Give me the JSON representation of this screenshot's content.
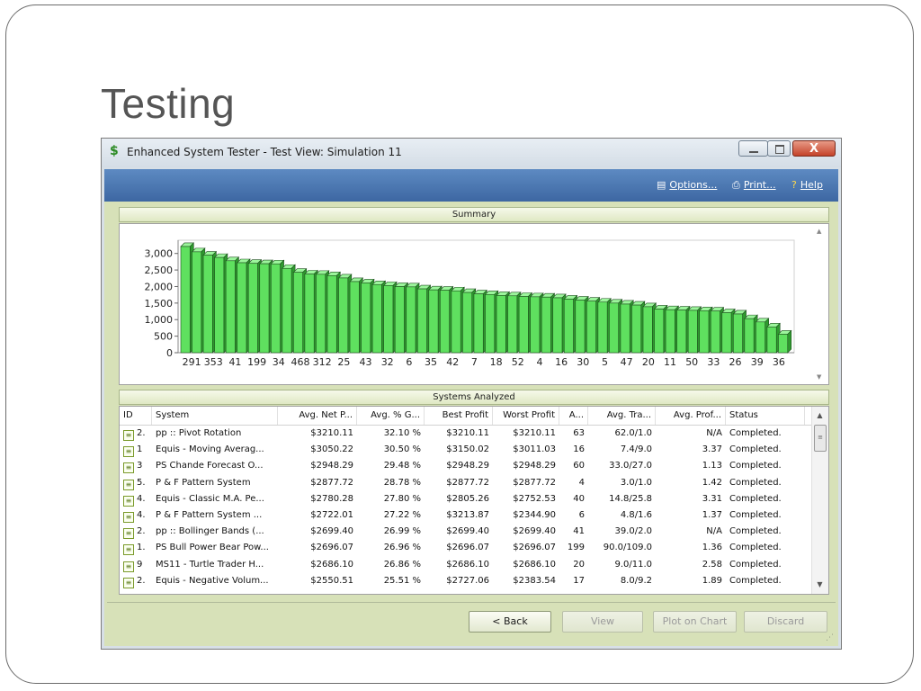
{
  "slide": {
    "title": "Testing"
  },
  "window": {
    "title": "Enhanced System Tester - Test View: Simulation 11",
    "icon": "dollar-icon",
    "close_label": "X"
  },
  "toolbar": {
    "options_label": "Options...",
    "print_label": "Print...",
    "help_label": "Help"
  },
  "summary": {
    "header": "Summary",
    "chart_data": {
      "type": "bar",
      "style": "3d",
      "bar_color": "#5fe05f",
      "ylim": [
        0,
        3400
      ],
      "yticks": [
        "3,000",
        "2,500",
        "2,000",
        "1,500",
        "1,000",
        "500",
        "0"
      ],
      "ytick_values": [
        3000,
        2500,
        2000,
        1500,
        1000,
        500,
        0
      ],
      "xtick_labels": [
        "291",
        "353",
        "41",
        "199",
        "34",
        "468",
        "312",
        "25",
        "43",
        "32",
        "6",
        "35",
        "42",
        "7",
        "18",
        "52",
        "4",
        "16",
        "30",
        "5",
        "47",
        "20",
        "11",
        "50",
        "33",
        "26",
        "39",
        "36"
      ],
      "values": [
        3210,
        3050,
        2950,
        2880,
        2780,
        2720,
        2700,
        2690,
        2686,
        2550,
        2430,
        2380,
        2370,
        2330,
        2260,
        2150,
        2110,
        2060,
        2030,
        2000,
        1990,
        1930,
        1900,
        1890,
        1870,
        1820,
        1780,
        1760,
        1730,
        1720,
        1700,
        1690,
        1680,
        1660,
        1620,
        1590,
        1560,
        1530,
        1500,
        1470,
        1440,
        1390,
        1320,
        1300,
        1290,
        1280,
        1270,
        1260,
        1210,
        1170,
        1030,
        930,
        780,
        560
      ]
    }
  },
  "systems": {
    "header": "Systems Analyzed",
    "columns": [
      "ID",
      "System",
      "Avg. Net P...",
      "Avg. % G...",
      "Best Profit",
      "Worst Profit",
      "A...",
      "Avg. Tra...",
      "Avg. Prof...",
      "Status"
    ],
    "rows": [
      [
        "2.",
        "pp :: Pivot Rotation",
        "$3210.11",
        "32.10 %",
        "$3210.11",
        "$3210.11",
        "63",
        "62.0/1.0",
        "N/A",
        "Completed."
      ],
      [
        "1",
        "Equis - Moving Averag...",
        "$3050.22",
        "30.50 %",
        "$3150.02",
        "$3011.03",
        "16",
        "7.4/9.0",
        "3.37",
        "Completed."
      ],
      [
        "3",
        "PS Chande Forecast O...",
        "$2948.29",
        "29.48 %",
        "$2948.29",
        "$2948.29",
        "60",
        "33.0/27.0",
        "1.13",
        "Completed."
      ],
      [
        "5.",
        "P & F Pattern System",
        "$2877.72",
        "28.78 %",
        "$2877.72",
        "$2877.72",
        "4",
        "3.0/1.0",
        "1.42",
        "Completed."
      ],
      [
        "4.",
        "Equis - Classic M.A. Pe...",
        "$2780.28",
        "27.80 %",
        "$2805.26",
        "$2752.53",
        "40",
        "14.8/25.8",
        "3.31",
        "Completed."
      ],
      [
        "4.",
        "P & F Pattern System ...",
        "$2722.01",
        "27.22 %",
        "$3213.87",
        "$2344.90",
        "6",
        "4.8/1.6",
        "1.37",
        "Completed."
      ],
      [
        "2.",
        "pp :: Bollinger Bands (...",
        "$2699.40",
        "26.99 %",
        "$2699.40",
        "$2699.40",
        "41",
        "39.0/2.0",
        "N/A",
        "Completed."
      ],
      [
        "1.",
        "PS Bull Power Bear Pow...",
        "$2696.07",
        "26.96 %",
        "$2696.07",
        "$2696.07",
        "199",
        "90.0/109.0",
        "1.36",
        "Completed."
      ],
      [
        "9",
        "MS11 - Turtle Trader H...",
        "$2686.10",
        "26.86 %",
        "$2686.10",
        "$2686.10",
        "20",
        "9.0/11.0",
        "2.58",
        "Completed."
      ],
      [
        "2.",
        "Equis - Negative Volum...",
        "$2550.51",
        "25.51 %",
        "$2727.06",
        "$2383.54",
        "17",
        "8.0/9.2",
        "1.89",
        "Completed."
      ]
    ]
  },
  "buttons": {
    "back": "< Back",
    "view": "View",
    "plot": "Plot on Chart",
    "discard": "Discard"
  }
}
